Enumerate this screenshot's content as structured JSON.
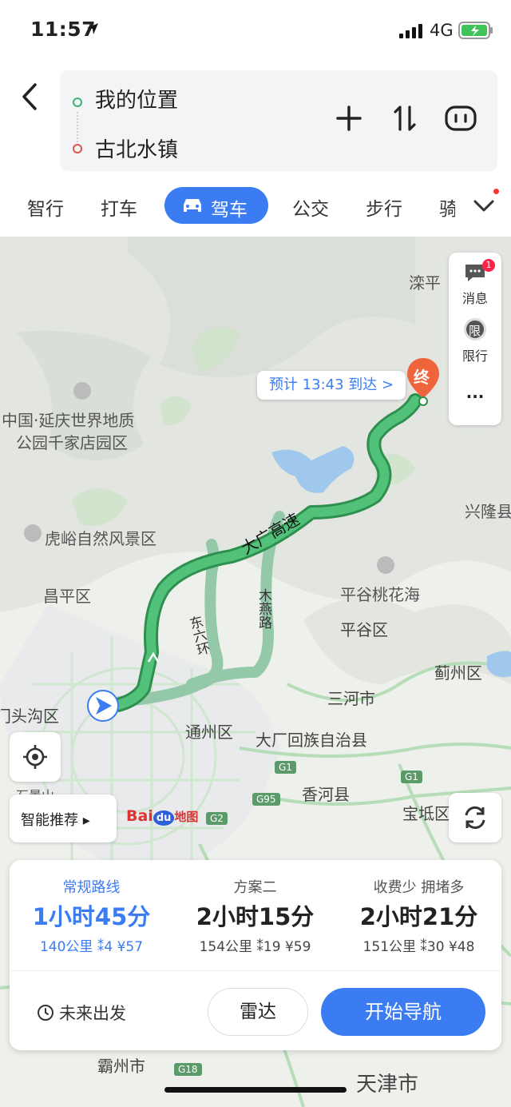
{
  "status_bar": {
    "time": "11:57",
    "network": "4G"
  },
  "header": {
    "from": "我的位置",
    "to": "古北水镇"
  },
  "tabs": [
    {
      "label": "智行"
    },
    {
      "label": "打车"
    },
    {
      "label": "驾车",
      "active": true
    },
    {
      "label": "公交"
    },
    {
      "label": "步行"
    },
    {
      "label": "骑"
    }
  ],
  "map": {
    "side_panel": {
      "messages_label": "消息",
      "messages_badge": "1",
      "restriction_label": "限行",
      "more_label": "···",
      "restriction_icon_text": "限"
    },
    "eta": "预计 13:43 到达 >",
    "end_marker": "终",
    "places": {
      "luanping": "滦平",
      "yanqing_park_1": "中国·延庆世界地质",
      "yanqing_park_2": "公园千家店园区",
      "xinglong": "兴隆县",
      "hushan": "虎峪自然风景区",
      "changping": "昌平区",
      "pinggu_peach": "平谷桃花海",
      "pinggu": "平谷区",
      "jizhou": "蓟州区",
      "sanhe": "三河市",
      "mentougou": "门头沟区",
      "tongzhou": "通州区",
      "dachang": "大厂回族自治县",
      "xianghe": "香河县",
      "baodi": "宝坻区",
      "bazhou": "霸州市",
      "tianjin": "天津市",
      "shijingshan": "石景山"
    },
    "road_labels": {
      "daguang": "大广高速",
      "dongliuhuan": "东六环",
      "muyan": "木燕路"
    },
    "highway_shields": [
      "G1",
      "G95",
      "G1",
      "G2",
      "G18"
    ],
    "smart_recommend": "智能推荐 ▸",
    "logo": {
      "left": "Bai",
      "mid": "du",
      "right": "地图"
    }
  },
  "routes": [
    {
      "title": "常规路线",
      "time": "1小时45分",
      "distance": "140公里",
      "lights": "4",
      "toll": "¥57",
      "active": true
    },
    {
      "title": "方案二",
      "time": "2小时15分",
      "distance": "154公里",
      "lights": "19",
      "toll": "¥59",
      "active": false
    },
    {
      "title": "收费少  拥堵多",
      "time": "2小时21分",
      "distance": "151公里",
      "lights": "30",
      "toll": "¥48",
      "active": false
    }
  ],
  "actions": {
    "future": "未来出发",
    "radar": "雷达",
    "navigate": "开始导航"
  },
  "colors": {
    "accent": "#3b7cf3",
    "route_main": "#3fae64",
    "route_alt": "#93c8a8",
    "end_marker": "#f0643c"
  }
}
